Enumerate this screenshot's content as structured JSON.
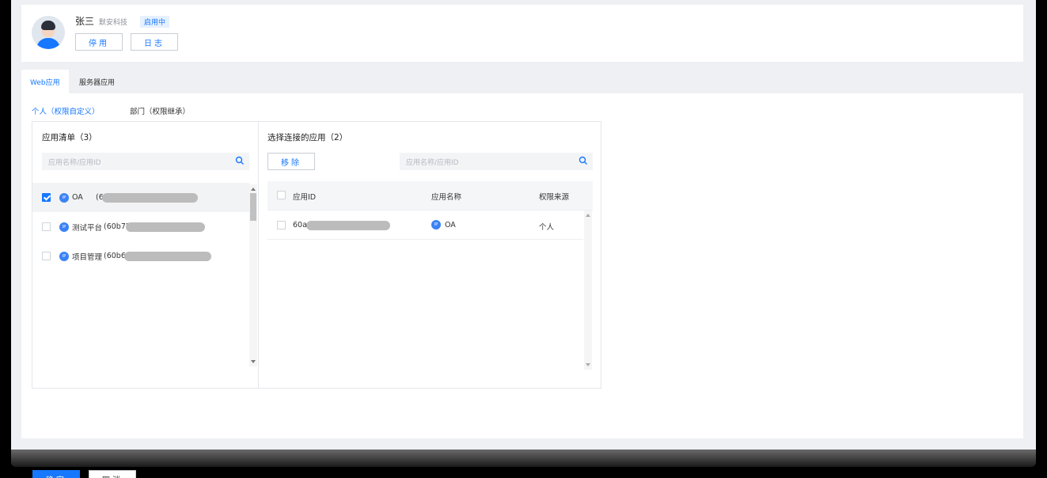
{
  "user": {
    "name": "张三",
    "company": "默安科技",
    "status": "启用中",
    "disable_label": "停用",
    "log_label": "日志"
  },
  "tabs": [
    {
      "label": "Web应用",
      "active": true
    },
    {
      "label": "服务器应用",
      "active": false
    }
  ],
  "subtabs": [
    {
      "label": "个人（权限自定义）",
      "active": true
    },
    {
      "label": "部门（权限继承）",
      "active": false
    }
  ],
  "app_list": {
    "title": "应用清单（3）",
    "search_placeholder": "应用名称/应用ID",
    "items": [
      {
        "name": "OA",
        "id_prefix": "(6",
        "checked": true,
        "icon": "app-badge-icon"
      },
      {
        "name": "测试平台",
        "id_prefix": "(60b72",
        "checked": false,
        "icon": "app-badge-icon"
      },
      {
        "name": "项目管理",
        "id_prefix": "(60b6",
        "checked": false,
        "icon": "app-badge-icon"
      }
    ]
  },
  "selected_apps": {
    "title": "选择连接的应用（2）",
    "remove_label": "移除",
    "search_placeholder": "应用名称/应用ID",
    "columns": [
      "应用ID",
      "应用名称",
      "权限来源"
    ],
    "rows": [
      {
        "app_id": "60a",
        "app_name": "OA",
        "source": "个人"
      }
    ]
  },
  "footer": {
    "confirm_label": "确定",
    "cancel_label": "取消"
  },
  "colors": {
    "accent": "#1677ff",
    "background": "#eef0f3"
  }
}
